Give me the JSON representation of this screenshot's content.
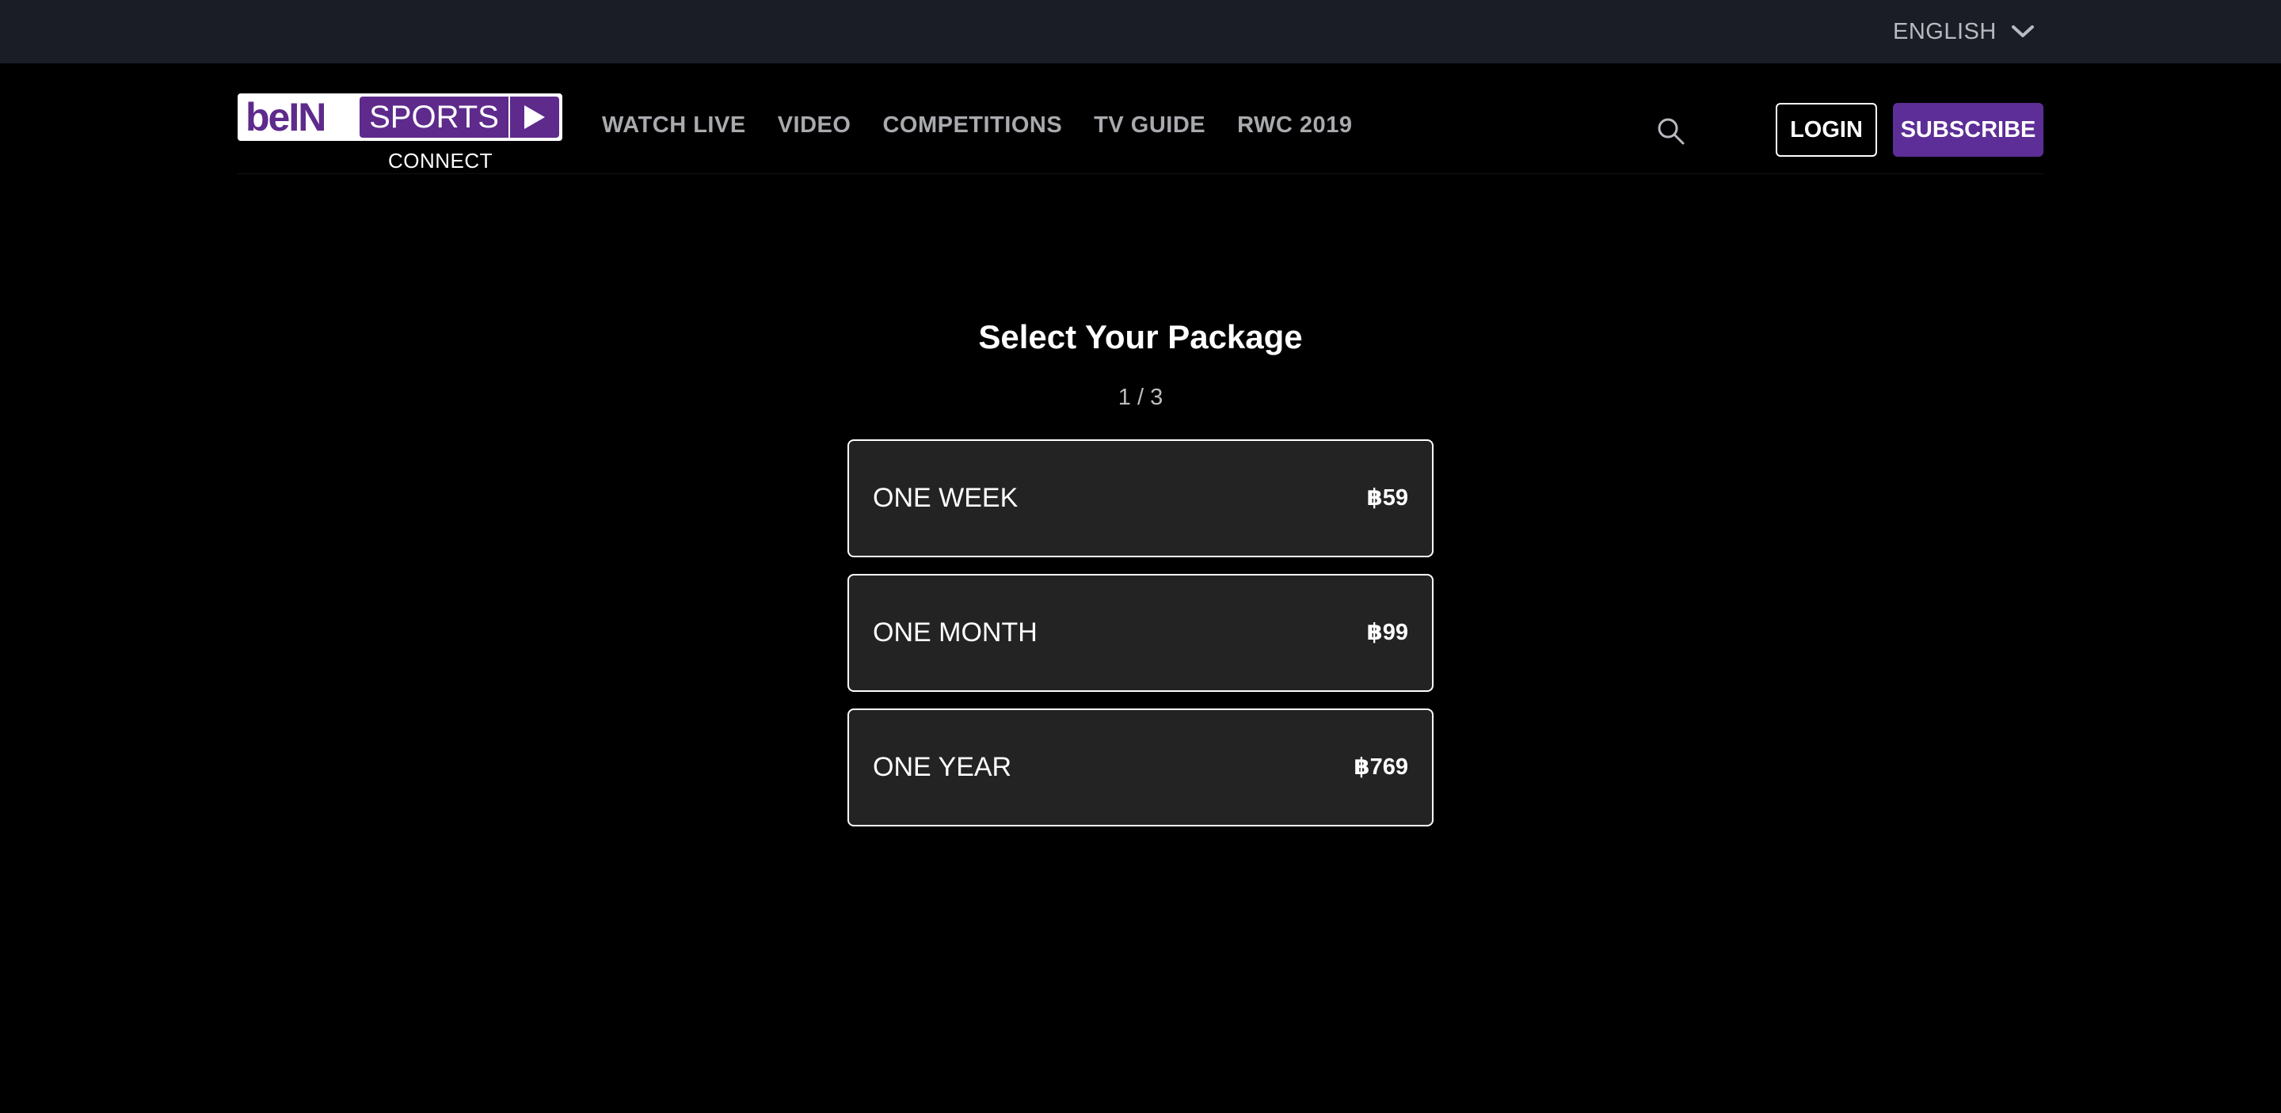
{
  "language": {
    "selected": "ENGLISH"
  },
  "logo": {
    "bein": "beIN",
    "sports": "SPORTS",
    "connect": "CONNECT"
  },
  "nav": {
    "items": [
      {
        "label": "WATCH LIVE"
      },
      {
        "label": "VIDEO"
      },
      {
        "label": "COMPETITIONS"
      },
      {
        "label": "TV GUIDE"
      },
      {
        "label": "RWC 2019"
      }
    ],
    "login_label": "LOGIN",
    "subscribe_label": "SUBSCRIBE"
  },
  "main": {
    "title": "Select Your Package",
    "step": "1 / 3",
    "packages": [
      {
        "name": "ONE WEEK",
        "price": "฿59"
      },
      {
        "name": "ONE MONTH",
        "price": "฿99"
      },
      {
        "name": "ONE YEAR",
        "price": "฿769"
      }
    ]
  },
  "colors": {
    "brand_purple": "#5d2e97",
    "top_bar": "#1a1c26",
    "card_bg": "#232323"
  },
  "icons": {
    "search": "search-icon",
    "language_dropdown": "chevron-down-icon",
    "logo_play": "play-icon"
  }
}
